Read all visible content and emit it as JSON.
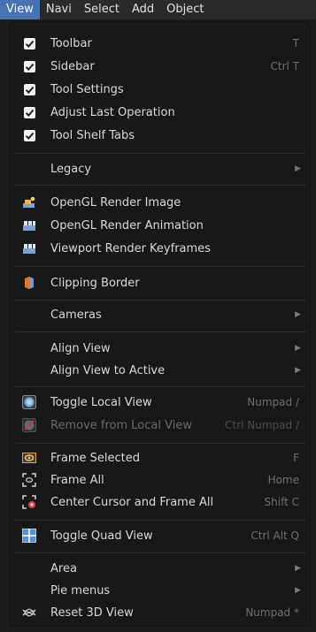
{
  "menubar": {
    "items": [
      "View",
      "Navi",
      "Select",
      "Add",
      "Object"
    ]
  },
  "colors": {
    "accent": "#4772b3",
    "menu_bg": "#181818",
    "text": "#d8d8d8",
    "shortcut": "#6f6f6f"
  },
  "menu": {
    "toolbar": {
      "label": "Toolbar",
      "shortcut": "T",
      "checked": true
    },
    "sidebar": {
      "label": "Sidebar",
      "shortcut": "Ctrl T",
      "checked": true
    },
    "tool_settings": {
      "label": "Tool Settings",
      "checked": true
    },
    "adjust_last": {
      "label": "Adjust Last Operation",
      "checked": true
    },
    "tool_shelf_tabs": {
      "label": "Tool Shelf Tabs",
      "checked": true
    },
    "legacy": {
      "label": "Legacy"
    },
    "opengl_image": {
      "label": "OpenGL Render Image",
      "icon": "render-still-icon"
    },
    "opengl_anim": {
      "label": "OpenGL Render Animation",
      "icon": "render-animation-icon"
    },
    "viewport_keyframes": {
      "label": "Viewport Render Keyframes",
      "icon": "render-animation-icon"
    },
    "clipping_border": {
      "label": "Clipping Border",
      "icon": "clip-border-icon"
    },
    "cameras": {
      "label": "Cameras"
    },
    "align_view": {
      "label": "Align View"
    },
    "align_view_active": {
      "label": "Align View to Active"
    },
    "toggle_local": {
      "label": "Toggle Local View",
      "shortcut": "Numpad /",
      "icon": "local-view-icon"
    },
    "remove_local": {
      "label": "Remove from Local View",
      "shortcut": "Ctrl Numpad /",
      "icon": "remove-local-icon",
      "disabled": true
    },
    "frame_selected": {
      "label": "Frame Selected",
      "shortcut": "F",
      "icon": "zoom-selected-icon"
    },
    "frame_all": {
      "label": "Frame All",
      "shortcut": "Home",
      "icon": "view-all-icon"
    },
    "center_cursor": {
      "label": "Center Cursor and Frame All",
      "shortcut": "Shift C",
      "icon": "center-cursor-icon"
    },
    "quad_view": {
      "label": "Toggle Quad View",
      "shortcut": "Ctrl Alt Q",
      "icon": "quad-view-icon"
    },
    "area": {
      "label": "Area"
    },
    "pie_menus": {
      "label": "Pie menus"
    },
    "reset_3d": {
      "label": "Reset 3D View",
      "shortcut": "Numpad *",
      "icon": "reset-view-icon"
    }
  }
}
